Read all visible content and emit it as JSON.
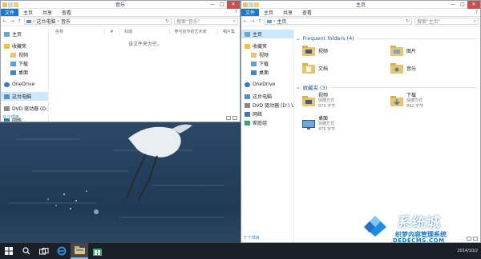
{
  "left_window": {
    "title": "音乐",
    "ribbon_tabs": [
      "文件",
      "主页",
      "共享",
      "查看"
    ],
    "address_path": [
      "这台电脑",
      "音乐"
    ],
    "search_placeholder": "搜索\"音乐\"",
    "nav": [
      {
        "label": "主页",
        "icon": "home-icon",
        "level": 0
      },
      {
        "label": "收藏夹",
        "icon": "star-icon",
        "level": 0
      },
      {
        "label": "视频",
        "icon": "video-folder-icon",
        "level": 1
      },
      {
        "label": "下载",
        "icon": "download-folder-icon",
        "level": 1
      },
      {
        "label": "桌面",
        "icon": "desktop-folder-icon",
        "level": 1
      },
      {
        "label": "OneDrive",
        "icon": "cloud-icon",
        "level": 0
      },
      {
        "label": "这台电脑",
        "icon": "computer-icon",
        "level": 0,
        "selected": true
      },
      {
        "label": "DVD 驱动器 (D:)",
        "icon": "dvd-drive-icon",
        "level": 0
      },
      {
        "label": "网络",
        "icon": "network-icon",
        "level": 0
      }
    ],
    "columns": [
      "名称",
      "#",
      "标题",
      "参与创作的艺术家",
      "唱片集"
    ],
    "empty_text": "该文件夹为空。",
    "status": "0 个项目"
  },
  "right_window": {
    "title": "主页",
    "ribbon_tabs": [
      "文件",
      "主页",
      "共享",
      "查看"
    ],
    "address_path": [
      "主页"
    ],
    "search_placeholder": "搜索\"主页\"",
    "nav": [
      {
        "label": "主页",
        "icon": "home-icon",
        "level": 0,
        "selected": true
      },
      {
        "label": "收藏夹",
        "icon": "star-icon",
        "level": 0
      },
      {
        "label": "视频",
        "icon": "video-folder-icon",
        "level": 1
      },
      {
        "label": "下载",
        "icon": "download-folder-icon",
        "level": 1
      },
      {
        "label": "桌面",
        "icon": "desktop-folder-icon",
        "level": 1
      },
      {
        "label": "OneDrive",
        "icon": "cloud-icon",
        "level": 0
      },
      {
        "label": "这台电脑",
        "icon": "computer-icon",
        "level": 0
      },
      {
        "label": "DVD 驱动器 (D:) VN",
        "icon": "dvd-drive-icon",
        "level": 0
      },
      {
        "label": "网络",
        "icon": "network-icon",
        "level": 0
      },
      {
        "label": "家庭组",
        "icon": "homegroup-icon",
        "level": 0
      }
    ],
    "frequent_header": "Frequent folders (4)",
    "frequent": [
      {
        "label": "视频"
      },
      {
        "label": "图片"
      },
      {
        "label": "文档"
      },
      {
        "label": "音乐"
      }
    ],
    "favorites_header": "收藏夹 (3)",
    "favorites": [
      {
        "label": "视频",
        "line2": "快捷方式",
        "line3": "875 字节"
      },
      {
        "label": "下载",
        "line2": "快捷方式",
        "line3": "892 字节"
      },
      {
        "label": "桌面",
        "line2": "快捷方式",
        "line3": "475 字节"
      }
    ],
    "status": "7 个项目"
  },
  "taskbar": {
    "items": [
      "start-icon",
      "search-icon",
      "task-view-icon",
      "ie-icon",
      "file-explorer-icon",
      "store-icon"
    ],
    "active": "file-explorer-icon",
    "date": "2014/10/2"
  },
  "watermark": {
    "big_text": "系统城",
    "line1": "织梦内容管理系统",
    "line2": "DEDECMS.COM"
  },
  "colors": {
    "accent": "#1979ca",
    "close": "#c75050",
    "folder": "#e9c46a",
    "taskbar": "#1b1f27"
  }
}
